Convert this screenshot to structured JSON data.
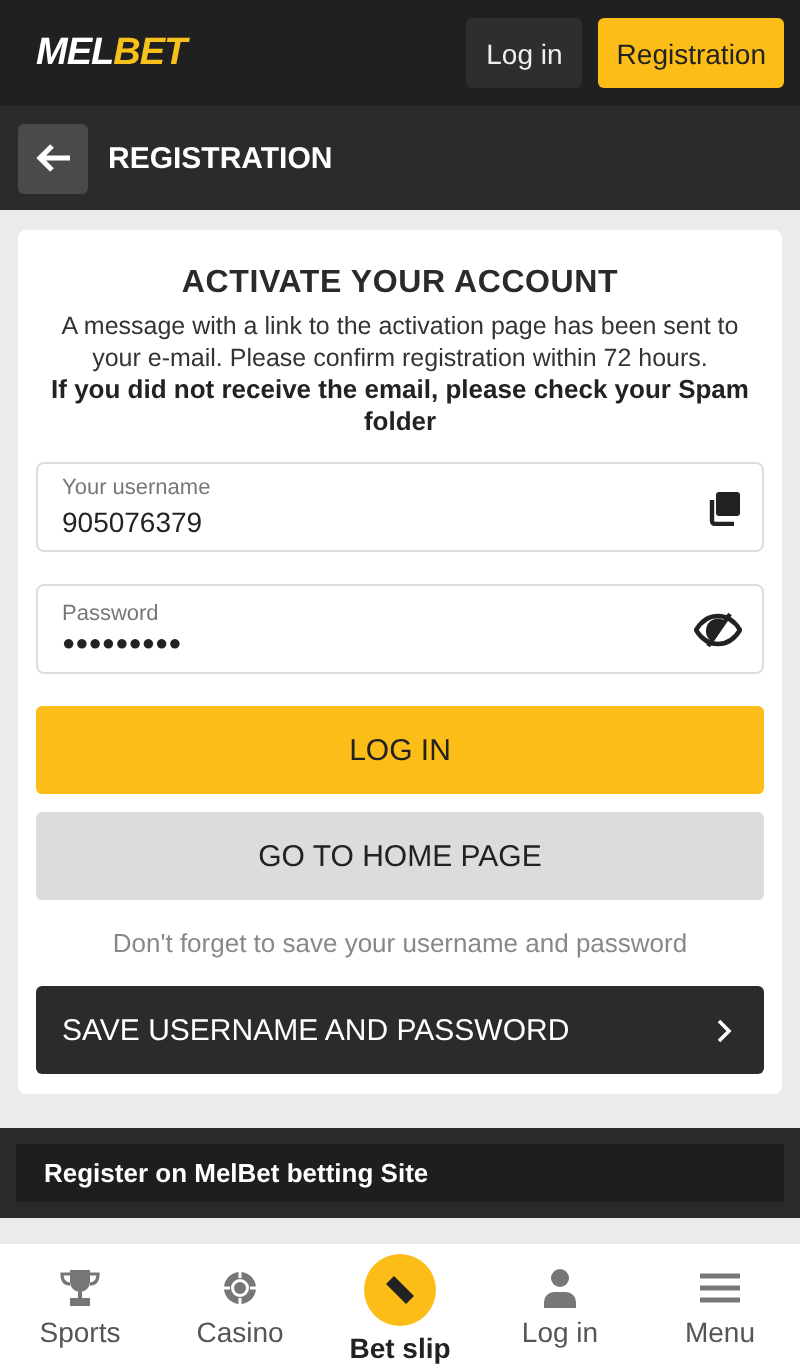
{
  "header": {
    "logo": {
      "part_1": "MEL",
      "part_2": "BET"
    },
    "login_button": "Log in",
    "registration_button": "Registration"
  },
  "subheader": {
    "title": "REGISTRATION"
  },
  "card": {
    "title": "ACTIVATE YOUR ACCOUNT",
    "message": "A message with a link to the activation page has been sent to your e-mail. Please confirm registration within 72 hours.",
    "notice": "If you did not receive the email, please check your Spam folder",
    "fields": [
      {
        "kind": "copy",
        "label": "Your username",
        "value": "905076379"
      },
      {
        "kind": "password",
        "label": "Password",
        "value": "●●●●●●●●●"
      }
    ],
    "login_button": "LOG IN",
    "home_button": "GO TO HOME PAGE",
    "hint": "Don't forget to save your username and password",
    "save_button": "SAVE USERNAME AND PASSWORD"
  },
  "footer_banner": "Register on MelBet betting Site",
  "bottom_nav": [
    {
      "kind": "sports",
      "label": "Sports",
      "selected": false
    },
    {
      "kind": "casino",
      "label": "Casino",
      "selected": false
    },
    {
      "kind": "betslip",
      "label": "Bet slip",
      "selected": true
    },
    {
      "kind": "login",
      "label": "Log in",
      "selected": false
    },
    {
      "kind": "menu",
      "label": "Menu",
      "selected": false
    }
  ]
}
